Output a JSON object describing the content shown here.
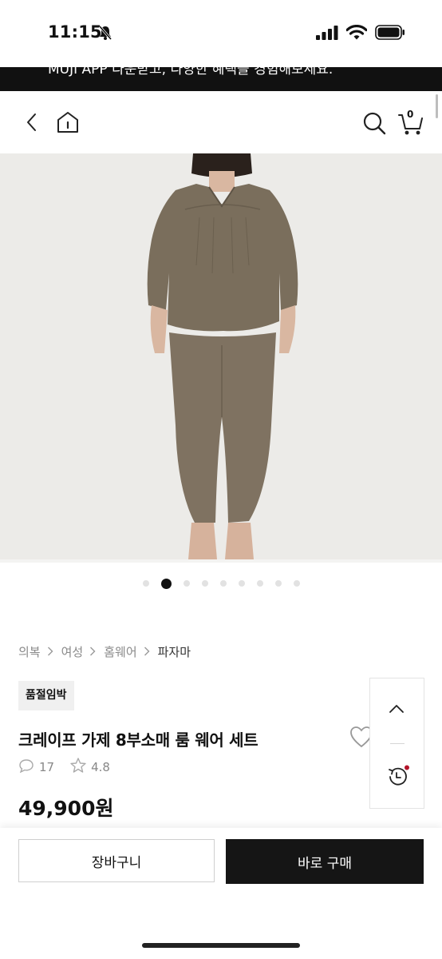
{
  "status_bar": {
    "time": "11:15",
    "icons": [
      "bell-slash-icon",
      "cellular-signal-icon",
      "wifi-icon",
      "battery-icon"
    ]
  },
  "banner": {
    "text": "MUJI APP 다운받고, 다양한 혜택을 경험해보세요."
  },
  "header": {
    "icons": [
      "back-chevron-icon",
      "home-icon",
      "search-icon",
      "cart-icon"
    ],
    "cart_count": "0"
  },
  "gallery": {
    "slide_count": 9,
    "active_index": 1
  },
  "breadcrumb": [
    "의복",
    "여성",
    "홈웨어",
    "파자마"
  ],
  "product": {
    "badge": "품절임박",
    "title": "크레이프 가제 8부소매 룸 웨어 세트",
    "review_count": "17",
    "rating": "4.8",
    "price": "49,900원"
  },
  "bottom_bar": {
    "cart_label": "장바구니",
    "buy_label": "바로 구매"
  },
  "colors": {
    "accent_dark": "#151515",
    "badge_bg": "#f0f0f0",
    "notification_dot": "#b3142a",
    "garment": "#7a6e5c"
  }
}
